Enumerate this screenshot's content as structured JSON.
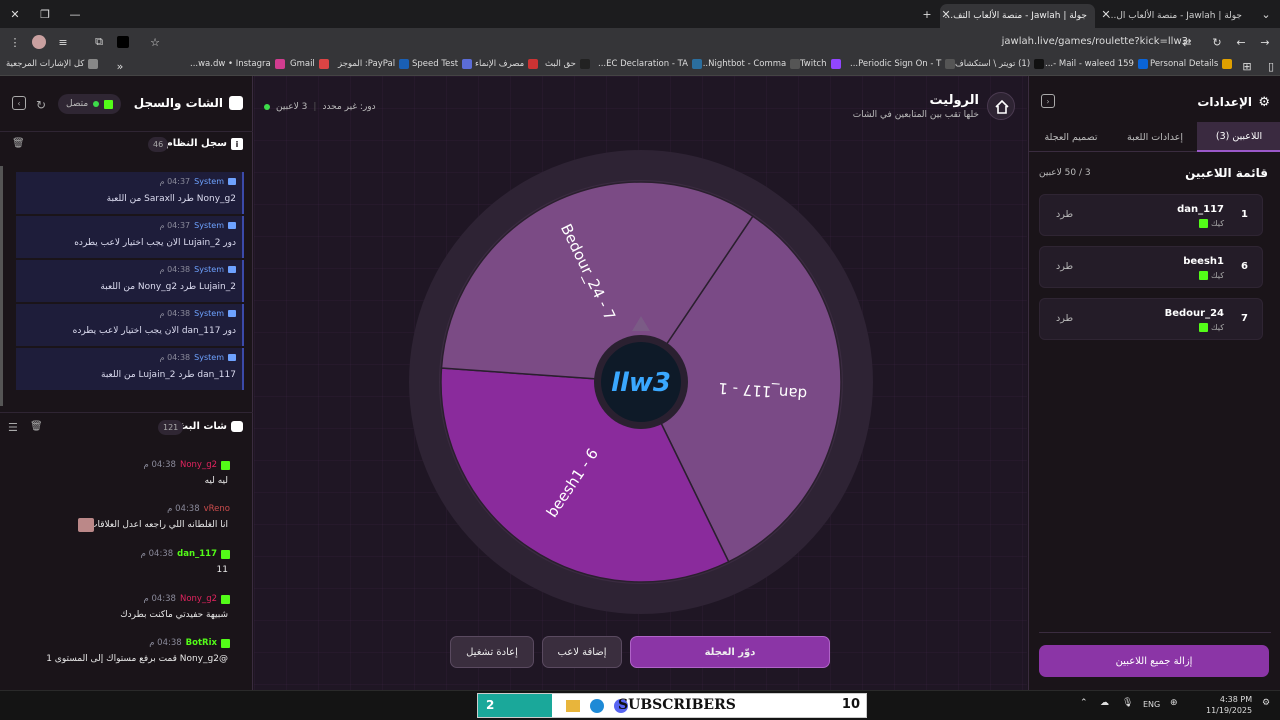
{
  "browser": {
    "tabs": [
      {
        "label": "جولة | Jawlah - منصة الألعاب التف..."
      },
      {
        "label": "جولة | Jawlah - منصة الألعاب ال..."
      }
    ],
    "url": "jawlah.live/games/roulette?kick=llw3",
    "bookmarks": [
      {
        "label": "Personal Details",
        "color": "#e0a000"
      },
      {
        "label": "Mail - waleed 159 -...",
        "color": "#0a64d8"
      },
      {
        "label": "(1) تويتر \\ استكشاف",
        "color": "#111"
      },
      {
        "label": "Periodic Sign On - T...",
        "color": "#555"
      },
      {
        "label": "Twitch",
        "color": "#9146ff"
      },
      {
        "label": "Nightbot - Comma...",
        "color": "#555"
      },
      {
        "label": "EC Declaration - TA...",
        "color": "#2b6e9e"
      },
      {
        "label": "حق البث",
        "color": "#222"
      },
      {
        "label": "مصرف الإنماء",
        "color": "#c33"
      },
      {
        "label": "Speed Test",
        "color": "#5b6cd6"
      },
      {
        "label": "PayPal: الموجز",
        "color": "#1a5fb4"
      },
      {
        "label": "Gmail",
        "color": "#d44"
      },
      {
        "label": "wa.dw • Instagra...",
        "color": "#d03c8f"
      },
      {
        "label": "كل الإشارات المرجعية",
        "color": "#888"
      }
    ]
  },
  "left": {
    "title": "الشات والسجل",
    "status": "متصل",
    "system_log": {
      "title": "سجل النظام",
      "count": "46",
      "entries": [
        {
          "who": "System",
          "time": "04:37 م",
          "msg": "Nony_g2 طرد Saraxll من اللعبة"
        },
        {
          "who": "System",
          "time": "04:37 م",
          "msg": "دور Lujain_2 الان يجب اختيار لاعب يطرده"
        },
        {
          "who": "System",
          "time": "04:38 م",
          "msg": "Lujain_2 طرد Nony_g2 من اللعبة"
        },
        {
          "who": "System",
          "time": "04:38 م",
          "msg": "دور dan_117 الان يجب اختيار لاعب يطرده"
        },
        {
          "who": "System",
          "time": "04:38 م",
          "msg": "dan_117 طرد Lujain_2 من اللعبة"
        }
      ]
    },
    "stream_chat": {
      "title": "شات البث",
      "count": "121",
      "messages": [
        {
          "user": "Nony_g2",
          "color": "#e0245e",
          "time": "04:38 م",
          "msg": "ليه ليه"
        },
        {
          "user": "vReno",
          "color": "#c94c4c",
          "time": "04:38 م",
          "msg": "انا الغلطانه اللي راجعه اعدل العلاقات"
        },
        {
          "user": "dan_117",
          "color": "#53fc18",
          "time": "04:38 م",
          "msg": "11"
        },
        {
          "user": "Nony_g2",
          "color": "#e0245e",
          "time": "04:38 م",
          "msg": "شبيهة حفيدتي ماكنت بطردك"
        },
        {
          "user": "BotRix",
          "color": "#53fc18",
          "time": "04:38 م",
          "msg": "@Nony_g2 قمت برفع مستواك إلى المستوى 1"
        }
      ]
    }
  },
  "game": {
    "title": "الروليت",
    "subtitle": "خلها تقب بين المتابعين في الشات",
    "players_online": "3 لاعبين",
    "turn": "دور: غير محدد",
    "center_logo": "llw3",
    "wheel_segments": [
      {
        "label": "dan_117 - 1",
        "color": "#7a4a86"
      },
      {
        "label": "beesh1 - 6",
        "color": "#8a2b9c"
      },
      {
        "label": "Bedour_24 - 7",
        "color": "#7b4b85"
      }
    ],
    "buttons": {
      "spin": "دوّر العجلة",
      "add": "إضافة لاعب",
      "restart": "إعادة تشغيل"
    }
  },
  "settings": {
    "title": "الإعدادات",
    "tabs": [
      "اللاعبين (3)",
      "إعدادات اللعبة",
      "تصميم العجلة"
    ],
    "list_title": "قائمة اللاعبين",
    "list_count": "3 / 50 لاعبين",
    "players": [
      {
        "num": "1",
        "name": "dan_117",
        "platform": "كيك",
        "action": "طرد"
      },
      {
        "num": "6",
        "name": "beesh1",
        "platform": "كيك",
        "action": "طرد"
      },
      {
        "num": "7",
        "name": "Bedour_24",
        "platform": "كيك",
        "action": "طرد"
      }
    ],
    "remove_all": "إزالة جميع اللاعبين"
  },
  "taskbar": {
    "left_num": "2",
    "banner": "SUBSCRIBERS",
    "right_num": "10",
    "lang": "ENG",
    "time": "4:38 PM",
    "date": "11/19/2025"
  }
}
